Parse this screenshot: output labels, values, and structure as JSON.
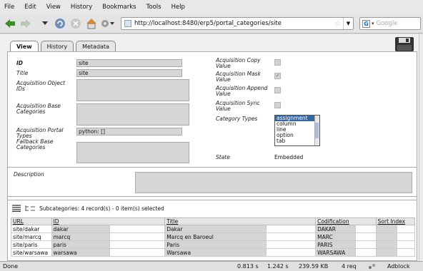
{
  "menu": [
    "File",
    "Edit",
    "View",
    "History",
    "Bookmarks",
    "Tools",
    "Help"
  ],
  "url": "http://localhost:8480/erp5/portal_categories/site",
  "search_placeholder": "Google",
  "tabs": [
    "View",
    "History",
    "Metadata"
  ],
  "fields": {
    "id_label": "ID",
    "id_value": "site",
    "title_label": "Title",
    "title_value": "site",
    "acq_obj_ids_label": "Acquisition Object IDs",
    "acq_base_cat_label": "Acquisition Base Categories",
    "acq_portal_types_label": "Acquisition Portal Types",
    "acq_portal_types_value": "python: []",
    "fallback_label": "Fallback Base Categories",
    "acq_copy_label": "Acquisition Copy Value",
    "acq_mask_label": "Acquisition Mask Value",
    "acq_append_label": "Acquisition Append Value",
    "acq_sync_label": "Acquisition Sync Value",
    "category_types_label": "Category Types",
    "category_types_options": [
      "assignment",
      "column",
      "line",
      "option",
      "tab"
    ],
    "state_label": "State",
    "state_value": "Embedded",
    "description_label": "Description"
  },
  "listbox": {
    "title": "Subcategories: 4 record(s) - 0 item(s) selected",
    "columns": [
      "URL",
      "ID",
      "Title",
      "Codification",
      "Sort Index"
    ],
    "rows": [
      [
        "site/dakar",
        "dakar",
        "Dakar",
        "DAKAR",
        ""
      ],
      [
        "site/marcq",
        "marcq",
        "Marcq en Baroeul",
        "MARC",
        ""
      ],
      [
        "site/paris",
        "paris",
        "Paris",
        "PARIS",
        ""
      ],
      [
        "site/warsawa",
        "warsawa",
        "Warsawa",
        "WARSAWA",
        ""
      ]
    ]
  },
  "status": {
    "text": "Done",
    "t1": "0.813 s",
    "t2": "1.242 s",
    "size": "239.59 KB",
    "req": "4 req",
    "adblock": "Adblock"
  }
}
